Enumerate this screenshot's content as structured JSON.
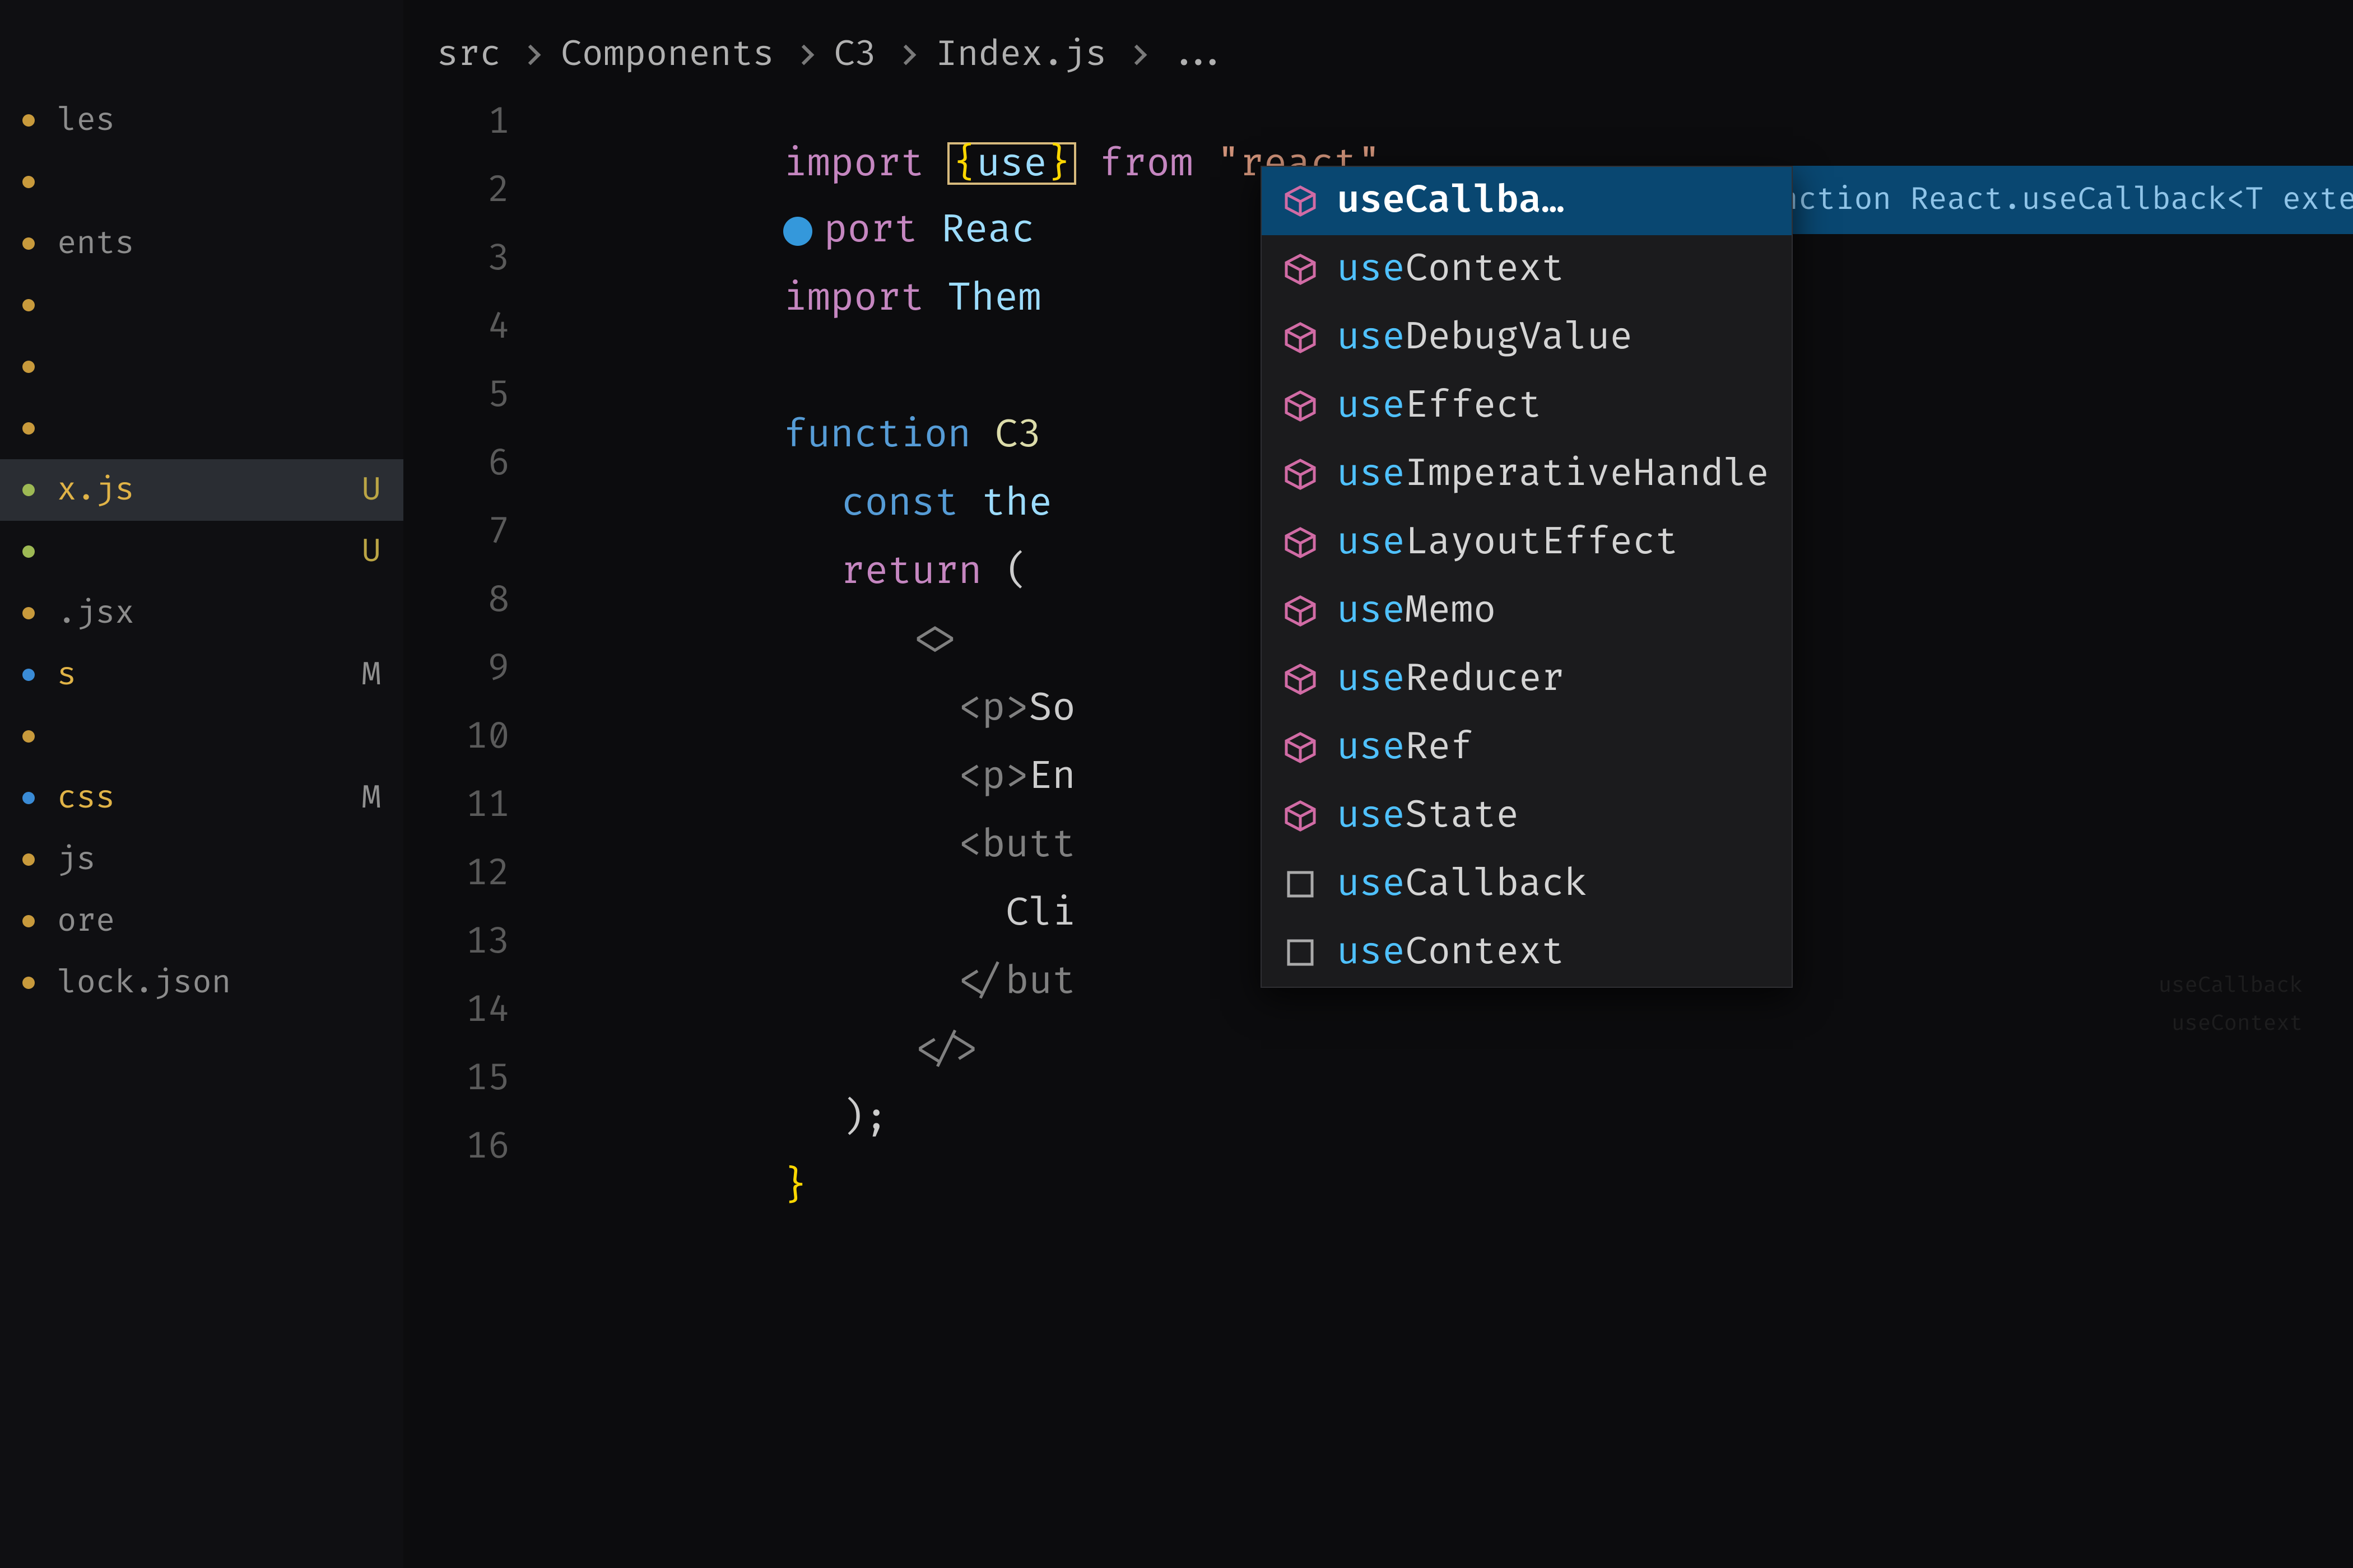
{
  "breadcrumb": {
    "parts": [
      "src",
      "Components",
      "C3",
      "Index.js",
      "..."
    ]
  },
  "sidebar": {
    "items": [
      {
        "label": "les",
        "status": "",
        "active": false
      },
      {
        "label": "",
        "status": "",
        "active": false
      },
      {
        "label": "ents",
        "status": "",
        "active": false
      },
      {
        "label": "",
        "status": "",
        "active": false
      },
      {
        "label": "",
        "status": "",
        "active": false
      },
      {
        "label": "",
        "status": "",
        "active": false
      },
      {
        "label": "x.js",
        "status": "U",
        "active": true
      },
      {
        "label": "",
        "status": "U",
        "active": false
      },
      {
        "label": ".jsx",
        "status": "",
        "active": false
      },
      {
        "label": "s",
        "status": "M",
        "active": false
      },
      {
        "label": "",
        "status": "",
        "active": false
      },
      {
        "label": "css",
        "status": "M",
        "active": false
      },
      {
        "label": "js",
        "status": "",
        "active": false
      },
      {
        "label": "ore",
        "status": "",
        "active": false
      },
      {
        "label": "lock.json",
        "status": "",
        "active": false
      }
    ]
  },
  "code": {
    "lines": {
      "1": {
        "import": "import",
        "lbrace": "{",
        "token": "use",
        "rbrace": "}",
        "from": "from",
        "pkg": "\"react\""
      },
      "2": {
        "prefix_port": "port",
        "react": "Reac"
      },
      "3": {
        "import": "import",
        "them": "Them"
      },
      "5": {
        "func": "function",
        "name": "C3"
      },
      "6": {
        "const": "const",
        "the": "the"
      },
      "7": {
        "return": "return",
        "paren": "("
      },
      "8": {
        "frag_open_l": "<",
        "frag_open_r": ">"
      },
      "9": {
        "open": "<p>",
        "text": "So"
      },
      "10": {
        "open": "<p>",
        "text": "En"
      },
      "11": {
        "open": "<butt"
      },
      "12": {
        "text": "Cli"
      },
      "13": {
        "close": "</but"
      },
      "14": {
        "frag_close_l": "</",
        "frag_close_r": ">"
      },
      "15": {
        "paren_close": ");"
      },
      "16": {
        "brace_close": "}"
      }
    },
    "line_numbers": [
      "1",
      "2",
      "3",
      "4",
      "5",
      "6",
      "7",
      "8",
      "9",
      "10",
      "11",
      "12",
      "13",
      "14",
      "15",
      "16"
    ]
  },
  "suggest": {
    "detail": "function React.useCallback<T extends…",
    "items": [
      {
        "kind": "method",
        "match": "use",
        "rest": "Callba…",
        "selected": true
      },
      {
        "kind": "method",
        "match": "use",
        "rest": "Context"
      },
      {
        "kind": "method",
        "match": "use",
        "rest": "DebugValue"
      },
      {
        "kind": "method",
        "match": "use",
        "rest": "Effect"
      },
      {
        "kind": "method",
        "match": "use",
        "rest": "ImperativeHandle"
      },
      {
        "kind": "method",
        "match": "use",
        "rest": "LayoutEffect"
      },
      {
        "kind": "method",
        "match": "use",
        "rest": "Memo"
      },
      {
        "kind": "method",
        "match": "use",
        "rest": "Reducer"
      },
      {
        "kind": "method",
        "match": "use",
        "rest": "Ref"
      },
      {
        "kind": "method",
        "match": "use",
        "rest": "State"
      },
      {
        "kind": "snippet",
        "match": "use",
        "rest": "Callback"
      },
      {
        "kind": "snippet",
        "match": "use",
        "rest": "Context"
      }
    ]
  },
  "minimap": {
    "lines": [
      "useCallback",
      "useContext"
    ]
  }
}
